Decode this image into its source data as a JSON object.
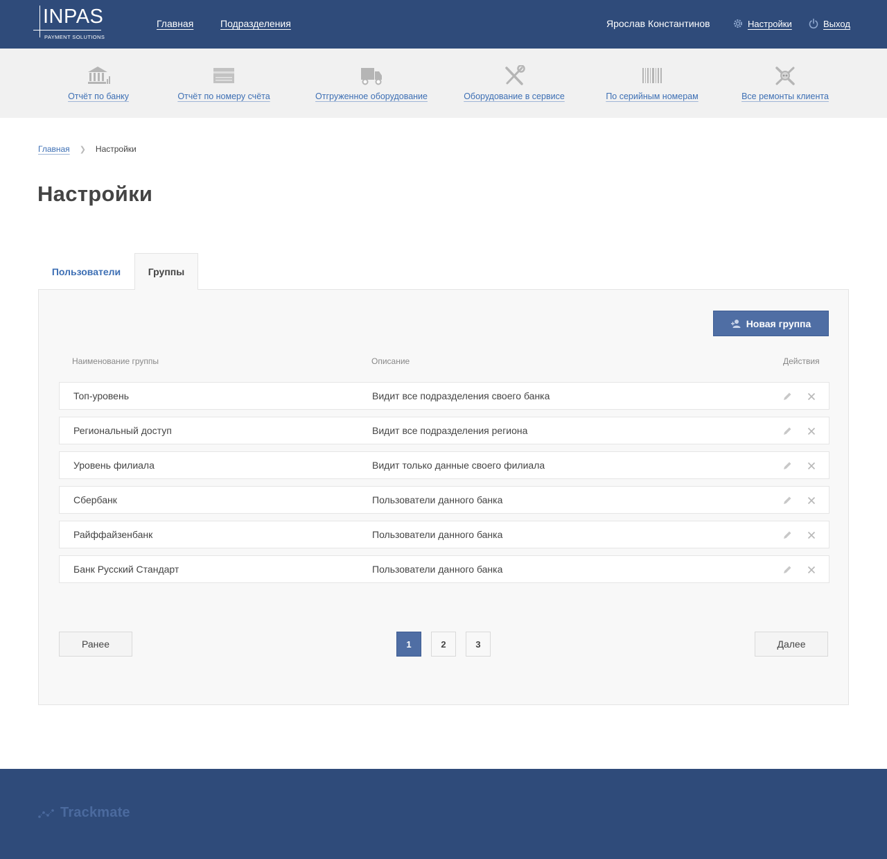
{
  "header": {
    "logo_text": "INPAS",
    "logo_sub": "PAYMENT SOLUTIONS",
    "nav": [
      {
        "label": "Главная"
      },
      {
        "label": "Подразделения"
      }
    ],
    "user_name": "Ярослав Константинов",
    "settings_label": "Настройки",
    "logout_label": "Выход"
  },
  "quickbar": [
    {
      "label": "Отчёт по банку",
      "icon": "bank-icon"
    },
    {
      "label": "Отчёт по номеру счёта",
      "icon": "card-icon"
    },
    {
      "label": "Отгруженное оборудование",
      "icon": "truck-icon"
    },
    {
      "label": "Оборудование в сервисе",
      "icon": "tools-icon"
    },
    {
      "label": "По серийным номерам",
      "icon": "barcode-icon"
    },
    {
      "label": "Все ремонты клиента",
      "icon": "repair-icon"
    }
  ],
  "breadcrumb": {
    "home": "Главная",
    "current": "Настройки"
  },
  "page_title": "Настройки",
  "tabs": [
    {
      "label": "Пользователи"
    },
    {
      "label": "Группы"
    }
  ],
  "new_group_label": "Новая группа",
  "table": {
    "columns": [
      "Наименование группы",
      "Описание",
      "Действия"
    ],
    "rows": [
      {
        "name": "Топ-уровень",
        "description": "Видит все подразделения своего банка"
      },
      {
        "name": "Региональный доступ",
        "description": "Видит все подразделения региона"
      },
      {
        "name": "Уровень филиала",
        "description": "Видит только данные своего филиала"
      },
      {
        "name": "Сбербанк",
        "description": "Пользователи данного банка"
      },
      {
        "name": "Райффайзенбанк",
        "description": "Пользователи данного банка"
      },
      {
        "name": "Банк Русский Стандарт",
        "description": "Пользователи данного банка"
      }
    ]
  },
  "pagination": {
    "prev": "Ранее",
    "next": "Далее",
    "pages": [
      "1",
      "2",
      "3"
    ],
    "current": "1"
  },
  "footer": {
    "brand": "Trackmate"
  },
  "colors": {
    "header_bg": "#2f4b7a",
    "accent": "#4f6ea4",
    "link": "#3d6fb4"
  }
}
